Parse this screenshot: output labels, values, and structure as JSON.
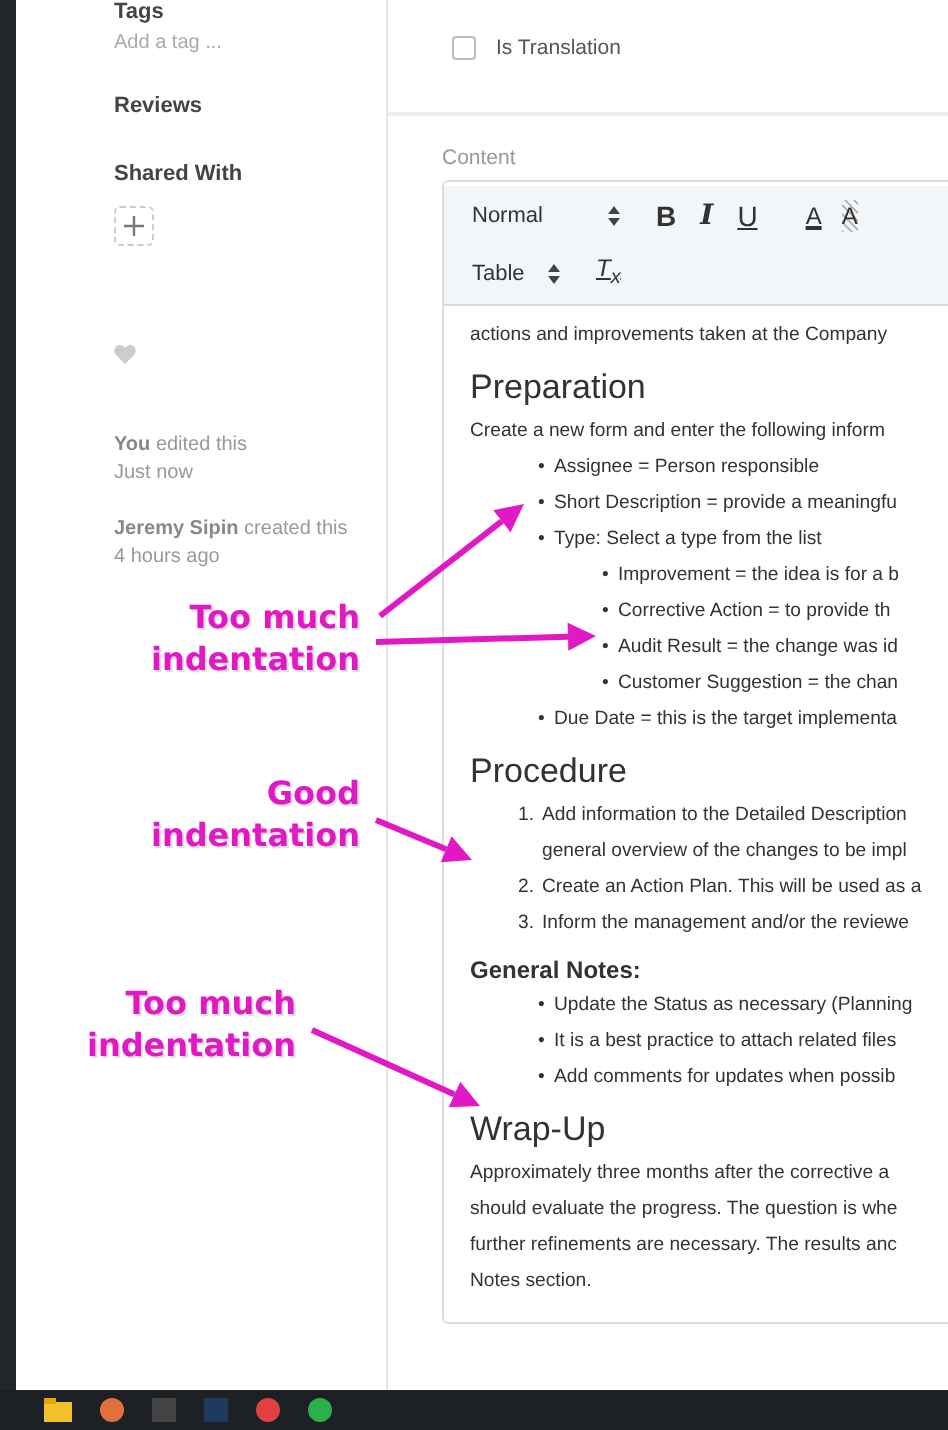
{
  "sidebar": {
    "tags_label": "Tags",
    "tag_placeholder": "Add a tag ...",
    "reviews_label": "Reviews",
    "shared_with_label": "Shared With",
    "activity": [
      {
        "actor": "You",
        "action": "edited this",
        "time": "Just now"
      },
      {
        "actor": "Jeremy Sipin",
        "action": "created this",
        "time": "4 hours ago"
      }
    ]
  },
  "is_translation": {
    "label": "Is Translation",
    "checked": false
  },
  "content": {
    "label": "Content",
    "toolbar": {
      "format": "Normal",
      "table": "Table",
      "buttons": [
        {
          "kind": "bold",
          "label": "B"
        },
        {
          "kind": "italic",
          "label": "I"
        },
        {
          "kind": "underline",
          "label": "U"
        },
        {
          "kind": "color",
          "label": "A"
        },
        {
          "kind": "background",
          "label": "A"
        }
      ],
      "clear": "T$_{x}$"
    },
    "blocks": [
      {
        "kind": "paragraph",
        "lines": [
          "actions and improvements taken at the Company"
        ]
      },
      {
        "kind": "heading",
        "text": "Preparation"
      },
      {
        "kind": "paragraph",
        "lines": [
          "Create a new form and enter the following inform"
        ]
      },
      {
        "kind": "bullets",
        "marker": "•",
        "items": [
          {
            "text": "Assignee = Person responsible"
          },
          {
            "text": "Short Description = provide a meaningfu"
          },
          {
            "text": "Type: Select a type from the list",
            "children": [
              {
                "text": "Improvement = the idea is for a b"
              },
              {
                "text": "Corrective Action = to provide th"
              },
              {
                "text": "Audit Result = the change was id"
              },
              {
                "text": "Customer Suggestion = the chan"
              }
            ]
          },
          {
            "text": "Due Date = this is the target implementa"
          }
        ]
      },
      {
        "kind": "heading",
        "text": "Procedure"
      },
      {
        "kind": "numbered",
        "items": [
          {
            "number": "1.",
            "lines": [
              "Add information to the Detailed Description",
              "general overview of the changes to be impl"
            ]
          },
          {
            "number": "2.",
            "lines": [
              "Create an Action Plan. This will be used as a"
            ]
          },
          {
            "number": "3.",
            "lines": [
              "Inform the management and/or the reviewe"
            ]
          }
        ]
      },
      {
        "kind": "subheading",
        "text": "General Notes:"
      },
      {
        "kind": "bullets",
        "marker": "•",
        "items": [
          {
            "text": "Update the Status as necessary (Planning"
          },
          {
            "text": "It is a best practice to attach related files"
          },
          {
            "text": "Add comments for updates when possib"
          }
        ]
      },
      {
        "kind": "heading",
        "text": "Wrap-Up"
      },
      {
        "kind": "paragraph",
        "lines": [
          "Approximately three months after the corrective a",
          "should evaluate the progress. The question is whe",
          "further refinements are necessary. The results anc",
          "Notes section."
        ]
      }
    ]
  },
  "annotations": [
    {
      "lines": [
        "Too much",
        "indentation"
      ]
    },
    {
      "lines": [
        "Good",
        "indentation"
      ]
    },
    {
      "lines": [
        "Too much",
        "indentation"
      ]
    }
  ]
}
